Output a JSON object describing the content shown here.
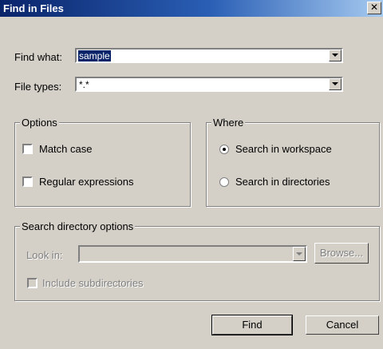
{
  "window": {
    "title": "Find in Files",
    "close_glyph": "✕"
  },
  "find": {
    "find_what_label": "Find what:",
    "find_what_value": "sample",
    "file_types_label": "File types:",
    "file_types_value": "*.*"
  },
  "options": {
    "legend": "Options",
    "match_case": {
      "label": "Match case",
      "checked": false
    },
    "regex": {
      "label": "Regular expressions",
      "checked": false
    }
  },
  "where": {
    "legend": "Where",
    "workspace": {
      "label": "Search in workspace",
      "selected": true
    },
    "directories": {
      "label": "Search in directories",
      "selected": false
    }
  },
  "dir_options": {
    "legend": "Search directory options",
    "look_in_label": "Look in:",
    "look_in_value": "",
    "browse_label": "Browse...",
    "include_subdirs_label": "Include subdirectories"
  },
  "buttons": {
    "find": "Find",
    "cancel": "Cancel"
  }
}
